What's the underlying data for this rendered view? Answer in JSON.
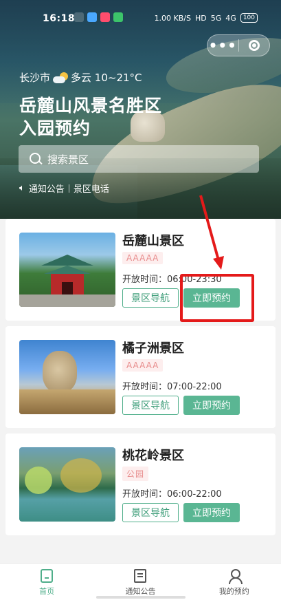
{
  "status_bar": {
    "time": "16:18",
    "net_speed": "1.00 KB/S",
    "network": "HD",
    "signal": "5G",
    "signal2": "4G",
    "battery": "100"
  },
  "capsule": {
    "more_icon": "more-dots-icon",
    "close_icon": "target-close-icon"
  },
  "header": {
    "city": "长沙市",
    "weather": "多云 10~21°C",
    "title_line1": "岳麓山风景名胜区",
    "title_line2": "入园预约",
    "search_placeholder": "搜索景区",
    "notice_link": "通知公告",
    "phone_link": "景区电话"
  },
  "scenic_spots": [
    {
      "name": "岳麓山景区",
      "level": "AAAAA",
      "hours": "开放时间：06:00-23:30",
      "nav_label": "景区导航",
      "book_label": "立即预约"
    },
    {
      "name": "橘子洲景区",
      "level": "AAAAA",
      "hours": "开放时间：07:00-22:00",
      "nav_label": "景区导航",
      "book_label": "立即预约"
    },
    {
      "name": "桃花岭景区",
      "level": "公园",
      "hours": "开放时间：06:00-22:00",
      "nav_label": "景区导航",
      "book_label": "立即预约"
    }
  ],
  "tabbar": [
    {
      "label": "首页",
      "icon": "home-icon",
      "active": true
    },
    {
      "label": "通知公告",
      "icon": "notice-icon",
      "active": false
    },
    {
      "label": "我的预约",
      "icon": "user-icon",
      "active": false
    }
  ],
  "colors": {
    "accent": "#5ab693",
    "badge_text": "#e88d8d",
    "annotation": "#e41a1a"
  }
}
